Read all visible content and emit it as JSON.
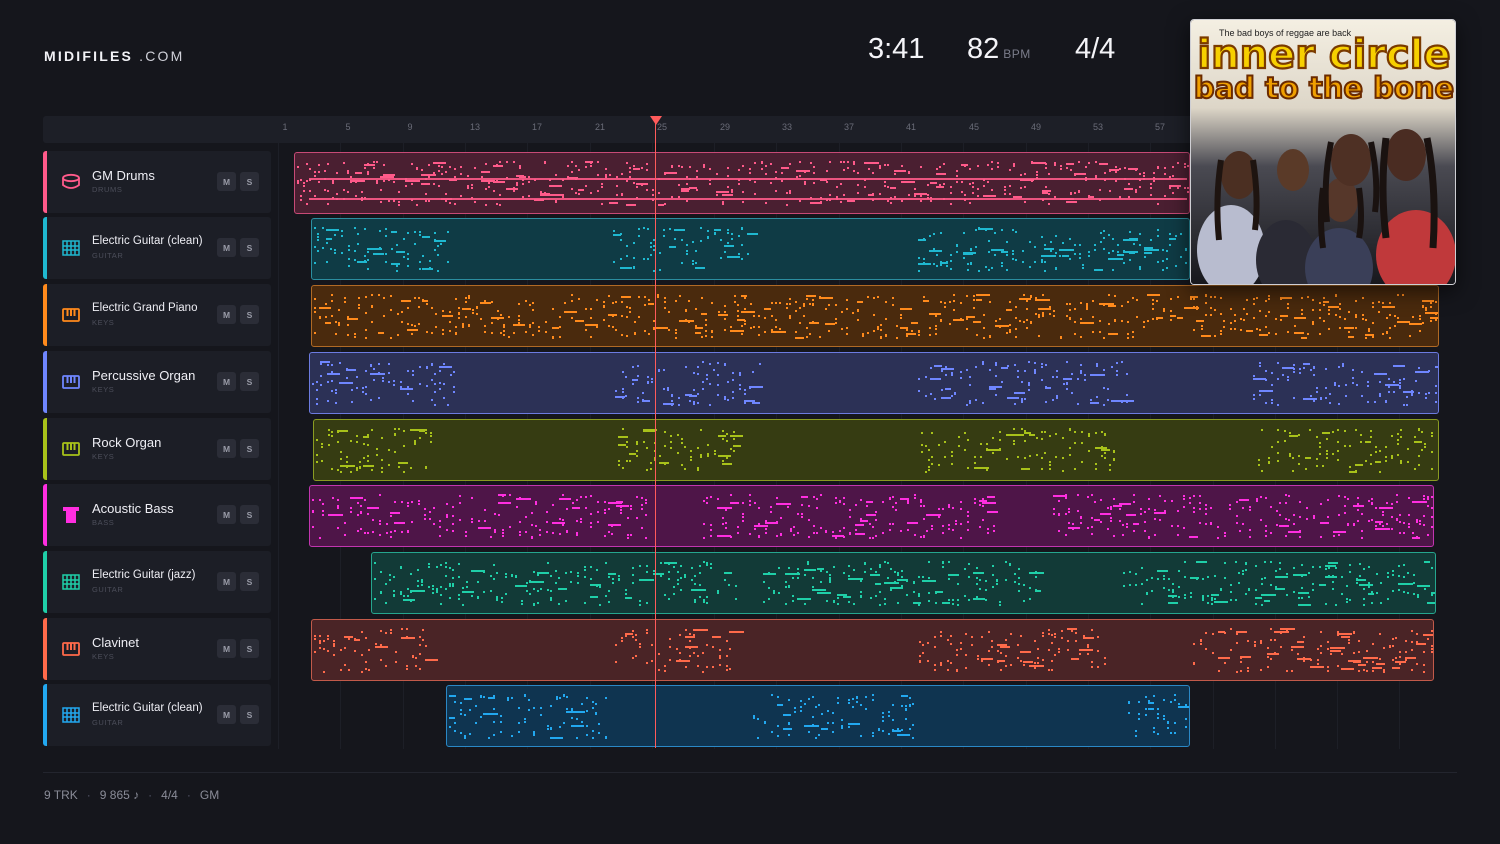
{
  "brand": {
    "name_bold": "MIDIFILES",
    "name_rest": ".COM"
  },
  "stats": {
    "time": "3:41",
    "bpm": "82",
    "bpm_unit": "BPM",
    "time_signature": "4/4"
  },
  "ruler": [
    "1",
    "5",
    "9",
    "13",
    "17",
    "21",
    "25",
    "29",
    "33",
    "37",
    "41",
    "45",
    "49",
    "53",
    "57"
  ],
  "tracks": [
    {
      "name": "GM Drums",
      "category": "DRUMS",
      "color": "#ff5a8a",
      "icon": "drum-icon",
      "mute": "M",
      "solo": "S"
    },
    {
      "name": "Electric Guitar (clean)",
      "category": "GUITAR",
      "color": "#1fb8d0",
      "icon": "guitar-fretboard-icon",
      "mute": "M",
      "solo": "S"
    },
    {
      "name": "Electric Grand Piano",
      "category": "KEYS",
      "color": "#ff8a1c",
      "icon": "piano-keys-icon",
      "mute": "M",
      "solo": "S"
    },
    {
      "name": "Percussive Organ",
      "category": "KEYS",
      "color": "#6f86ff",
      "icon": "piano-keys-icon",
      "mute": "M",
      "solo": "S"
    },
    {
      "name": "Rock Organ",
      "category": "KEYS",
      "color": "#a8c21a",
      "icon": "piano-keys-icon",
      "mute": "M",
      "solo": "S"
    },
    {
      "name": "Acoustic Bass",
      "category": "BASS",
      "color": "#ff2ee0",
      "icon": "bass-icon",
      "mute": "M",
      "solo": "S"
    },
    {
      "name": "Electric Guitar (jazz)",
      "category": "GUITAR",
      "color": "#1fcfa8",
      "icon": "guitar-fretboard-icon",
      "mute": "M",
      "solo": "S"
    },
    {
      "name": "Clavinet",
      "category": "KEYS",
      "color": "#ff6a4a",
      "icon": "piano-keys-icon",
      "mute": "M",
      "solo": "S"
    },
    {
      "name": "Electric Guitar (clean)",
      "category": "GUITAR",
      "color": "#22a8f0",
      "icon": "guitar-fretboard-icon",
      "mute": "M",
      "solo": "S"
    }
  ],
  "album": {
    "tagline": "The bad boys of reggae are back",
    "artist": "inner circle",
    "title": "bad to the bone"
  },
  "footer": {
    "tracks": "9 TRK",
    "notes": "9 865 ♪",
    "signature": "4/4",
    "mode": "GM"
  }
}
